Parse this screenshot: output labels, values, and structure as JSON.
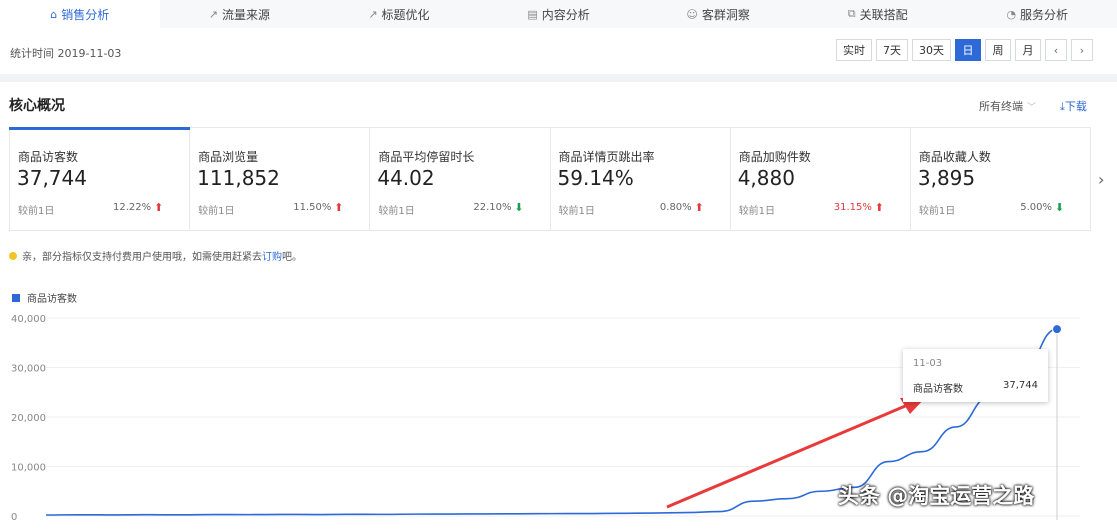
{
  "tabs": [
    {
      "label": "销售分析",
      "icon": "bag-icon",
      "active": true
    },
    {
      "label": "流量来源",
      "icon": "trend-icon",
      "active": false
    },
    {
      "label": "标题优化",
      "icon": "trend-icon",
      "active": false
    },
    {
      "label": "内容分析",
      "icon": "document-icon",
      "active": false
    },
    {
      "label": "客群洞察",
      "icon": "users-icon",
      "active": false
    },
    {
      "label": "关联搭配",
      "icon": "link-icon",
      "active": false
    },
    {
      "label": "服务分析",
      "icon": "headset-icon",
      "active": false
    }
  ],
  "toolbar": {
    "stat_time": "统计时间 2019-11-03",
    "periods": [
      "实时",
      "7天",
      "30天",
      "日",
      "周",
      "月"
    ],
    "active_period": "日",
    "prev": "‹",
    "next": "›"
  },
  "overview": {
    "title": "核心概况",
    "terminal": "所有终端",
    "download": "下载"
  },
  "metrics": [
    {
      "label": "商品访客数",
      "value": "37,744",
      "compare": "较前1日",
      "pct": "12.22%",
      "trend": "up"
    },
    {
      "label": "商品浏览量",
      "value": "111,852",
      "compare": "较前1日",
      "pct": "11.50%",
      "trend": "up"
    },
    {
      "label": "商品平均停留时长",
      "value": "44.02",
      "compare": "较前1日",
      "pct": "22.10%",
      "trend": "down"
    },
    {
      "label": "商品详情页跳出率",
      "value": "59.14%",
      "compare": "较前1日",
      "pct": "0.80%",
      "trend": "up"
    },
    {
      "label": "商品加购件数",
      "value": "4,880",
      "compare": "较前1日",
      "pct": "31.15%",
      "trend": "up"
    },
    {
      "label": "商品收藏人数",
      "value": "3,895",
      "compare": "较前1日",
      "pct": "5.00%",
      "trend": "down"
    }
  ],
  "notice": {
    "text": "亲，部分指标仅支持付费用户使用哦，如需使用赶紧去",
    "link": "订购",
    "suffix": "吧。"
  },
  "colors": {
    "accent": "#2d6ad8",
    "up": "#e4393c",
    "down": "#1a9d4c",
    "annotation_arrow": "#e83a3a"
  },
  "watermark": "头条 @淘宝运营之路",
  "chart_data": {
    "type": "line",
    "legend": "商品访客数",
    "yticks": [
      "40,000",
      "30,000",
      "20,000",
      "10,000",
      "0"
    ],
    "ylim": [
      0,
      40000
    ],
    "grid": true,
    "series": [
      {
        "name": "商品访客数",
        "values": [
          200,
          250,
          220,
          260,
          240,
          300,
          280,
          320,
          300,
          350,
          330,
          380,
          400,
          420,
          450,
          480,
          500,
          550,
          600,
          700,
          900,
          3000,
          3500,
          5000,
          5800,
          11000,
          13000,
          18000,
          24000,
          30000,
          37744
        ]
      }
    ],
    "tooltip": {
      "date": "11-03",
      "name": "商品访客数",
      "value": "37,744"
    }
  }
}
